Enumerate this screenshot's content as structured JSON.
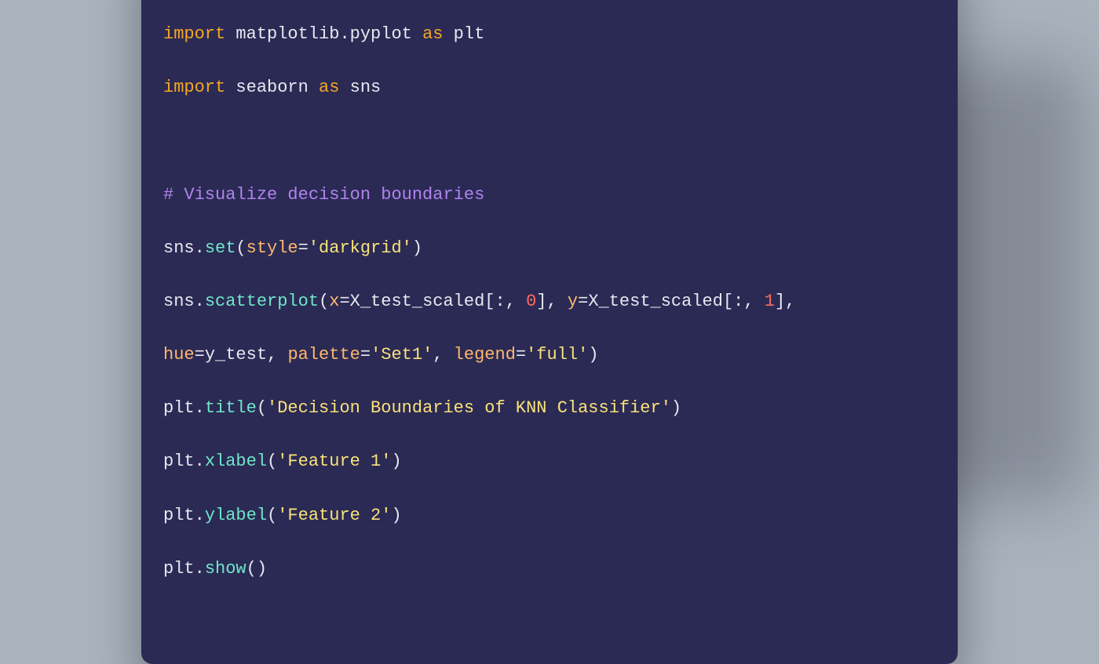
{
  "window": {
    "traffic": {
      "red": "#ff5f56",
      "yellow": "#ffbd2e",
      "green": "#27c93f"
    }
  },
  "code": {
    "l1": {
      "kw1": "import",
      "mod": "matplotlib.pyplot",
      "kw2": "as",
      "alias": "plt"
    },
    "l2": {
      "kw1": "import",
      "mod": "seaborn",
      "kw2": "as",
      "alias": "sns"
    },
    "l3": {
      "comment": "# Visualize decision boundaries"
    },
    "l4": {
      "obj": "sns",
      "dot": ".",
      "fn": "set",
      "op": "(",
      "arg1": "style",
      "eq": "=",
      "str1": "'darkgrid'",
      "cp": ")"
    },
    "l5": {
      "obj": "sns",
      "dot": ".",
      "fn": "scatterplot",
      "op": "(",
      "argx": "x",
      "eq1": "=",
      "xexpr_a": "X_test_scaled[:,",
      "sp1": " ",
      "num0": "0",
      "xexpr_b": "],",
      "sp2": " ",
      "argy": "y",
      "eq2": "=",
      "yexpr_a": "X_test_scaled[:,",
      "sp3": " ",
      "num1": "1",
      "yexpr_b": "],"
    },
    "l6": {
      "arg_hue": "hue",
      "eq1": "=",
      "hueval": "y_test",
      "c1": ", ",
      "arg_pal": "palette",
      "eq2": "=",
      "palval": "'Set1'",
      "c2": ", ",
      "arg_leg": "legend",
      "eq3": "=",
      "legval": "'full'",
      "cp": ")"
    },
    "l7": {
      "obj": "plt",
      "dot": ".",
      "fn": "title",
      "op": "(",
      "str": "'Decision Boundaries of KNN Classifier'",
      "cp": ")"
    },
    "l8": {
      "obj": "plt",
      "dot": ".",
      "fn": "xlabel",
      "op": "(",
      "str": "'Feature 1'",
      "cp": ")"
    },
    "l9": {
      "obj": "plt",
      "dot": ".",
      "fn": "ylabel",
      "op": "(",
      "str": "'Feature 2'",
      "cp": ")"
    },
    "l10": {
      "obj": "plt",
      "dot": ".",
      "fn": "show",
      "op": "(",
      "cp": ")"
    }
  }
}
